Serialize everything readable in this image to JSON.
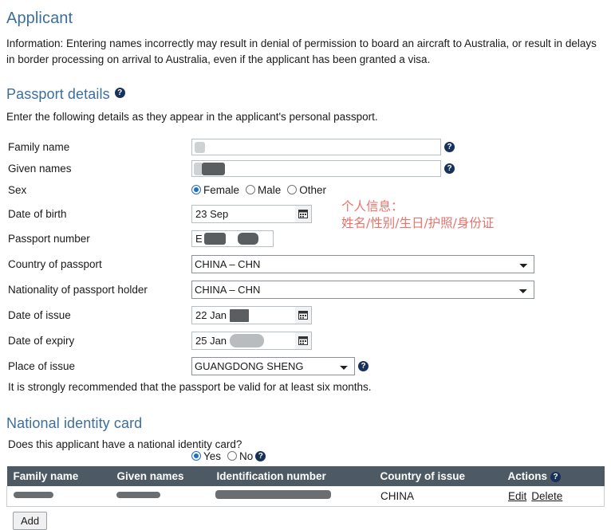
{
  "header": {
    "title": "Applicant",
    "info": "Information: Entering names incorrectly may result in denial of permission to board an aircraft to Australia, or result in delays in border processing on arrival to Australia, even if the applicant has been granted a visa."
  },
  "passport": {
    "title": "Passport details",
    "help_icon": "?",
    "instruction": "Enter the following details as they appear in the applicant's personal passport.",
    "fields": {
      "family_name": {
        "label": "Family name",
        "value": ""
      },
      "given_names": {
        "label": "Given names",
        "value": ""
      },
      "sex": {
        "label": "Sex",
        "options": [
          "Female",
          "Male",
          "Other"
        ],
        "selected": "Female"
      },
      "date_of_birth": {
        "label": "Date of birth",
        "value": "23 Sep"
      },
      "passport_number": {
        "label": "Passport number",
        "value": "E"
      },
      "country_of_passport": {
        "label": "Country of passport",
        "value": "CHINA – CHN"
      },
      "nationality": {
        "label": "Nationality of passport holder",
        "value": "CHINA – CHN"
      },
      "date_of_issue": {
        "label": "Date of issue",
        "value": "22 Jan"
      },
      "date_of_expiry": {
        "label": "Date of expiry",
        "value": "25 Jan"
      },
      "place_of_issue": {
        "label": "Place of issue",
        "value": "GUANGDONG SHENG"
      }
    },
    "note": "It is strongly recommended that the passport be valid for at least six months."
  },
  "identity_card": {
    "title": "National identity card",
    "question": "Does this applicant have a national identity card?",
    "options": [
      "Yes",
      "No"
    ],
    "selected": "Yes",
    "table": {
      "columns": [
        "Family name",
        "Given names",
        "Identification number",
        "Country of issue",
        "Actions"
      ],
      "rows": [
        {
          "family_name": "",
          "given_names": "",
          "identification_number": "",
          "country_of_issue": "CHINA",
          "actions": {
            "edit": "Edit",
            "delete": "Delete"
          }
        }
      ]
    },
    "add_label": "Add"
  },
  "annotation": {
    "text": "个人信息：\n姓名/性别/生日/护照/身份证",
    "color": "#e8736b"
  },
  "colors": {
    "heading": "#3c6e9f",
    "table_header_bg": "#4e5a63",
    "radio_selected": "#1f6fc4",
    "help_icon_bg": "#16315c"
  }
}
